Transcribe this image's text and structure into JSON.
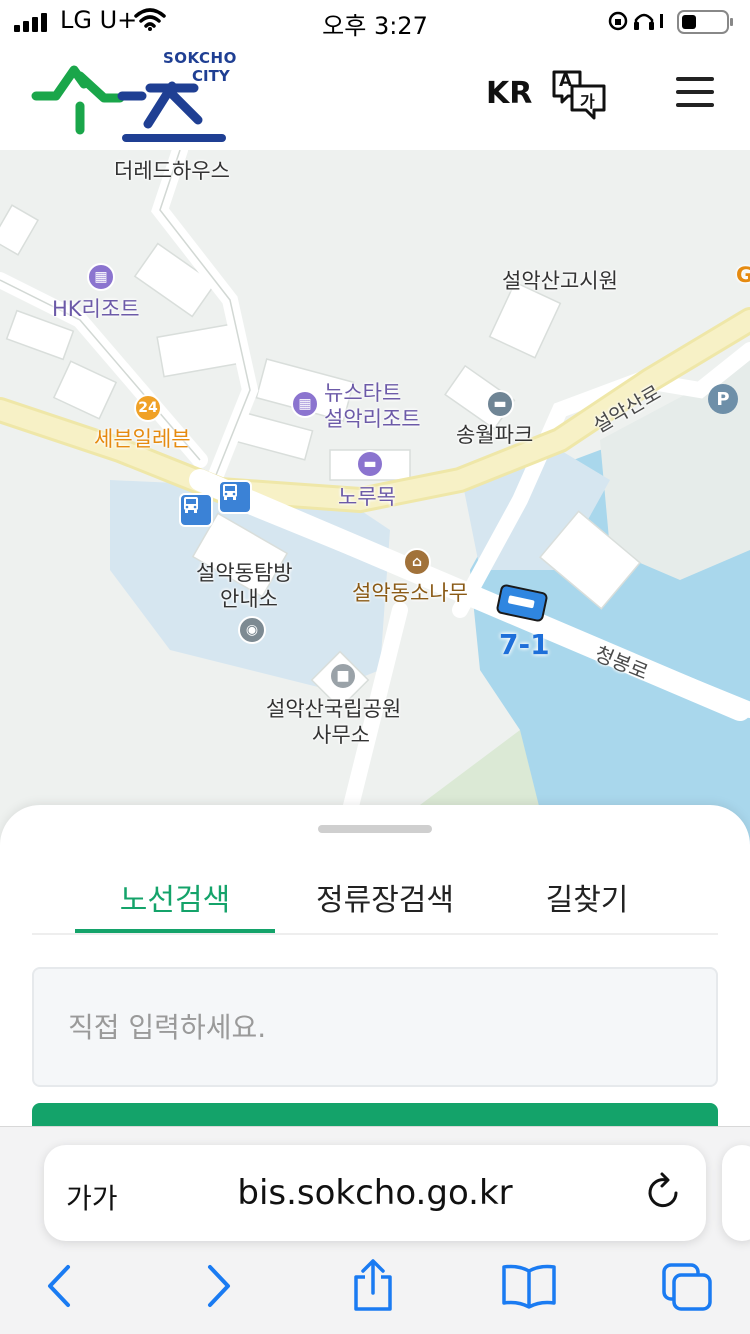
{
  "status_bar": {
    "carrier": "LG U+",
    "time": "오후 3:27"
  },
  "header": {
    "logo_top_text": "SOKCHO",
    "logo_bottom_text": "CITY",
    "lang_label": "KR",
    "translate_icon_a": "A",
    "translate_icon_b": "가"
  },
  "map": {
    "places": {
      "the_red_house": "더레드하우스",
      "hk_resort": "HK리조트",
      "seven_eleven": "세븐일레븐",
      "newstart_line1": "뉴스타트",
      "newstart_line2": "설악리조트",
      "norumok": "노루목",
      "seorak_gosiwon": "설악산고시원",
      "songwol_park": "송월파크",
      "tourist_info_line1": "설악동탐방",
      "tourist_info_line2": "안내소",
      "seorak_sonamu": "설악동소나무",
      "park_office_line1": "설악산국립공원",
      "park_office_line2": "사무소",
      "partial_label": "G"
    },
    "roads": {
      "seoraksan_ro": "설악산로",
      "cheongbong_ro": "청봉로"
    },
    "poi_24h": "24",
    "parking": "P",
    "bus_route_label": "7-1"
  },
  "sheet": {
    "tabs": [
      {
        "label": "노선검색",
        "active": true
      },
      {
        "label": "정류장검색",
        "active": false
      },
      {
        "label": "길찾기",
        "active": false
      }
    ],
    "search_placeholder": "직접 입력하세요."
  },
  "browser": {
    "aa_label": "가가",
    "url": "bis.sokcho.go.kr"
  },
  "colors": {
    "brand_green": "#14a36a",
    "logo_blue": "#1f3f93",
    "logo_green": "#1aa64a",
    "bus_blue": "#3b82d6",
    "map_road": "#f5f1c4",
    "map_water": "#a9d7ec"
  }
}
